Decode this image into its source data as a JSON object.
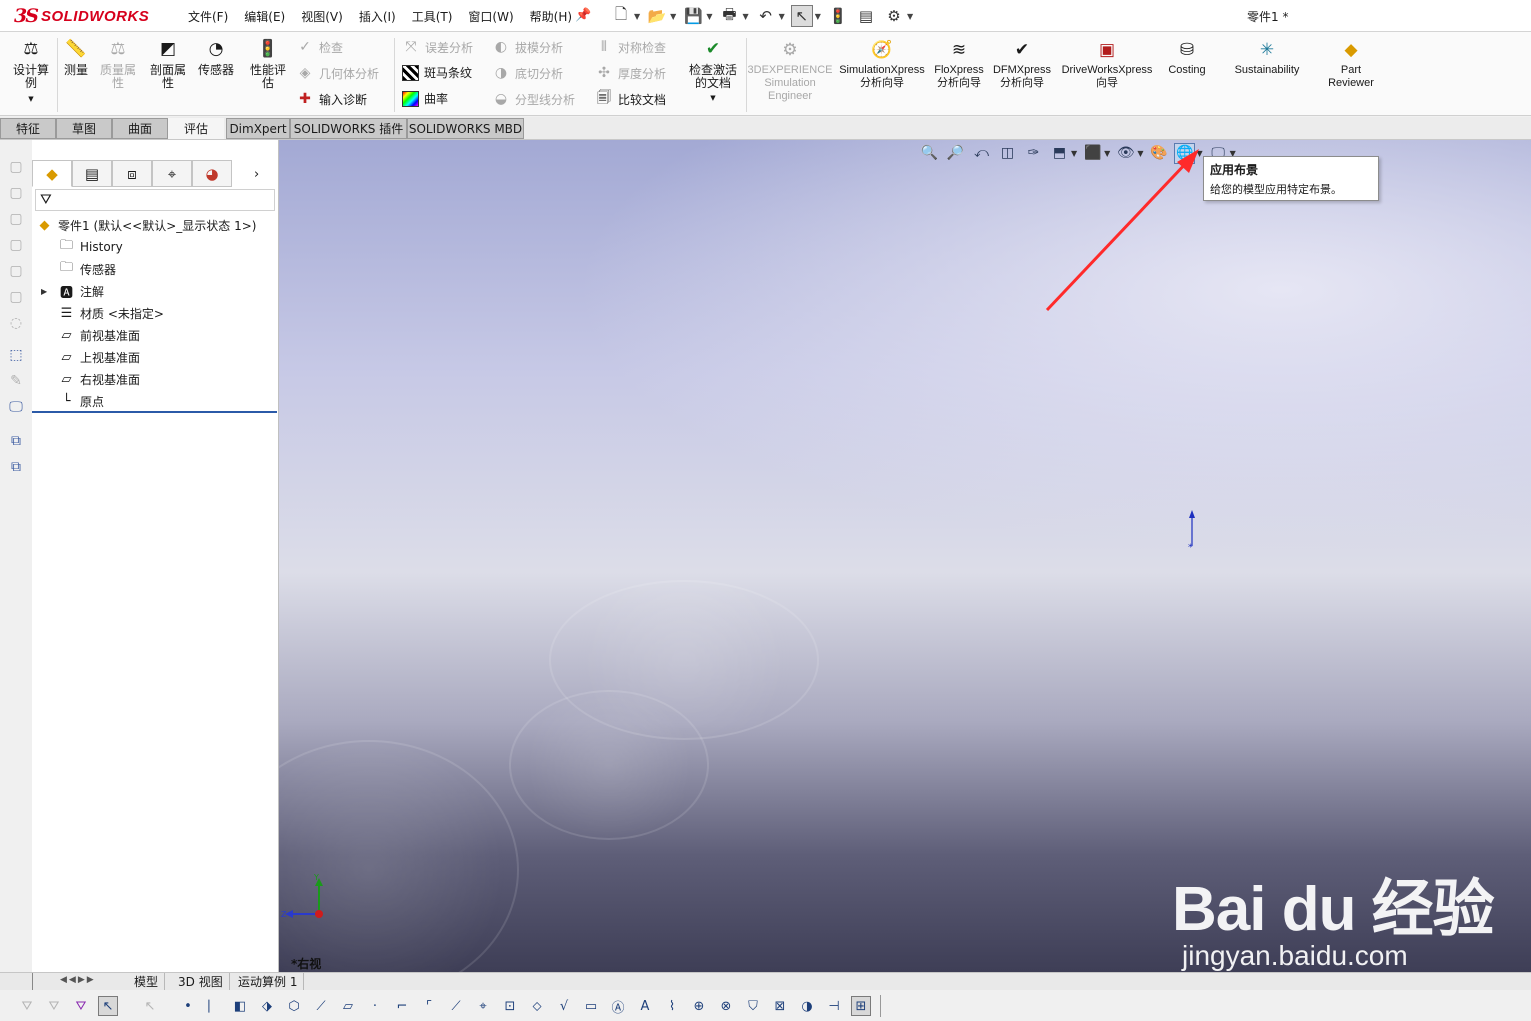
{
  "title_bar": {
    "brand": "SOLIDWORKS",
    "brand_mark": "3S",
    "document_title": "零件1 *",
    "menu": [
      "文件(F)",
      "编辑(E)",
      "视图(V)",
      "插入(I)",
      "工具(T)",
      "窗口(W)",
      "帮助(H)"
    ],
    "quick_access_icons": [
      "new-icon",
      "open-icon",
      "save-icon",
      "print-icon",
      "undo-icon",
      "select-icon",
      "traffic-light-icon",
      "file-properties-icon",
      "options-gear-icon"
    ]
  },
  "ribbon": {
    "design_study": "设计算例",
    "measure": "测量",
    "mass_properties": "质量属性",
    "section_properties": "剖面属性",
    "sensor": "传感器",
    "performance_eval": "性能评估",
    "check": "检查",
    "geometry_analysis": "几何体分析",
    "import_diagnostics": "输入诊断",
    "deviation_analysis": "误差分析",
    "zebra_stripes": "斑马条纹",
    "curvature": "曲率",
    "draft_analysis": "拔模分析",
    "undercut_analysis": "底切分析",
    "parting_line_analysis": "分型线分析",
    "symmetry_check": "对称检查",
    "thickness_analysis": "厚度分析",
    "compare_documents": "比较文档",
    "check_active_document": "检查激活的文档",
    "threedx_simulation": "3DEXPERIENCE Simulation Engineer",
    "simulationxpress": "SimulationXpress 分析向导",
    "floxpress": "FloXpress 分析向导",
    "dfmxpress": "DFMXpress 分析向导",
    "driveworksxpress": "DriveWorksXpress 向导",
    "costing": "Costing",
    "sustainability": "Sustainability",
    "part_reviewer": "Part Reviewer"
  },
  "tabs": [
    "特征",
    "草图",
    "曲面",
    "评估",
    "DimXpert",
    "SOLIDWORKS 插件",
    "SOLIDWORKS MBD"
  ],
  "active_tab": "评估",
  "feature_tree": {
    "root": "零件1  (默认<<默认>_显示状态 1>)",
    "items": [
      {
        "label": "History",
        "icon": "history-folder-icon"
      },
      {
        "label": "传感器",
        "icon": "sensor-folder-icon"
      },
      {
        "label": "注解",
        "icon": "annotation-folder-icon",
        "expandable": true
      },
      {
        "label": "材质 <未指定>",
        "icon": "material-icon"
      },
      {
        "label": "前视基准面",
        "icon": "plane-icon"
      },
      {
        "label": "上视基准面",
        "icon": "plane-icon"
      },
      {
        "label": "右视基准面",
        "icon": "plane-icon"
      },
      {
        "label": "原点",
        "icon": "origin-icon"
      }
    ]
  },
  "viewport": {
    "view_name": "*右视",
    "tooltip": {
      "title": "应用布景",
      "body": "给您的模型应用特定布景。"
    }
  },
  "status_tabs": [
    "模型",
    "3D 视图",
    "运动算例 1"
  ],
  "watermark": {
    "main": "Bai du 经验",
    "sub": "jingyan.baidu.com"
  },
  "colors": {
    "brand_red": "#d6001c",
    "arrow_red": "#ff2a2a",
    "tree_accent": "#2b5aa8"
  }
}
